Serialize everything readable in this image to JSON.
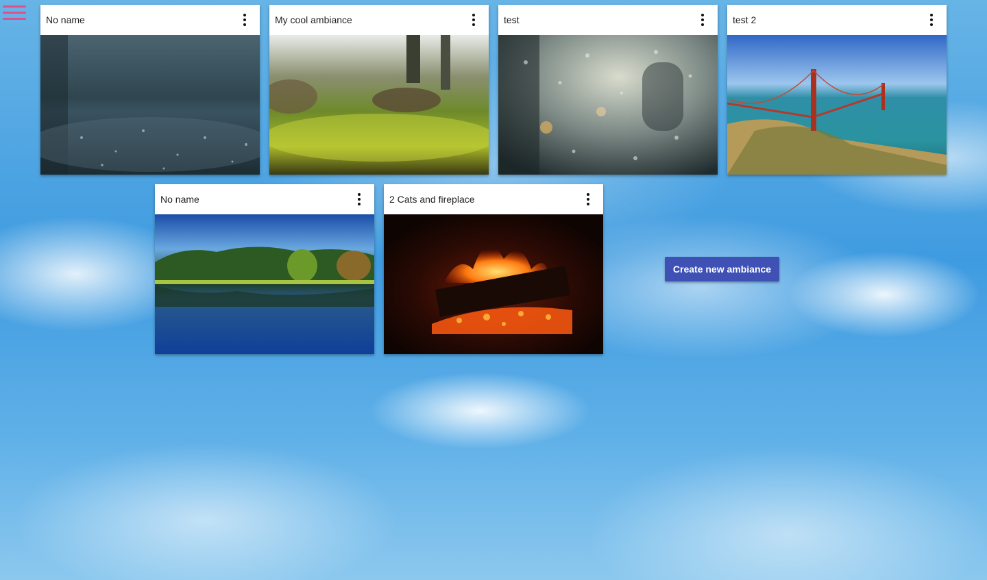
{
  "menu": {
    "icon": "hamburger-menu-icon",
    "color": "#e0508a"
  },
  "ambiances": [
    {
      "name": "No name",
      "scene": "rain-on-ground"
    },
    {
      "name": "My cool ambiance",
      "scene": "mossy-forest-floor"
    },
    {
      "name": "test",
      "scene": "rain-on-window"
    },
    {
      "name": "test 2",
      "scene": "golden-gate-bridge"
    },
    {
      "name": "No name",
      "scene": "lake-reflection"
    },
    {
      "name": "2 Cats and fireplace",
      "scene": "fireplace"
    }
  ],
  "card_menu_icon": "more-vert-icon",
  "create_button": {
    "label": "Create new ambiance",
    "color": "#3f51b5"
  }
}
